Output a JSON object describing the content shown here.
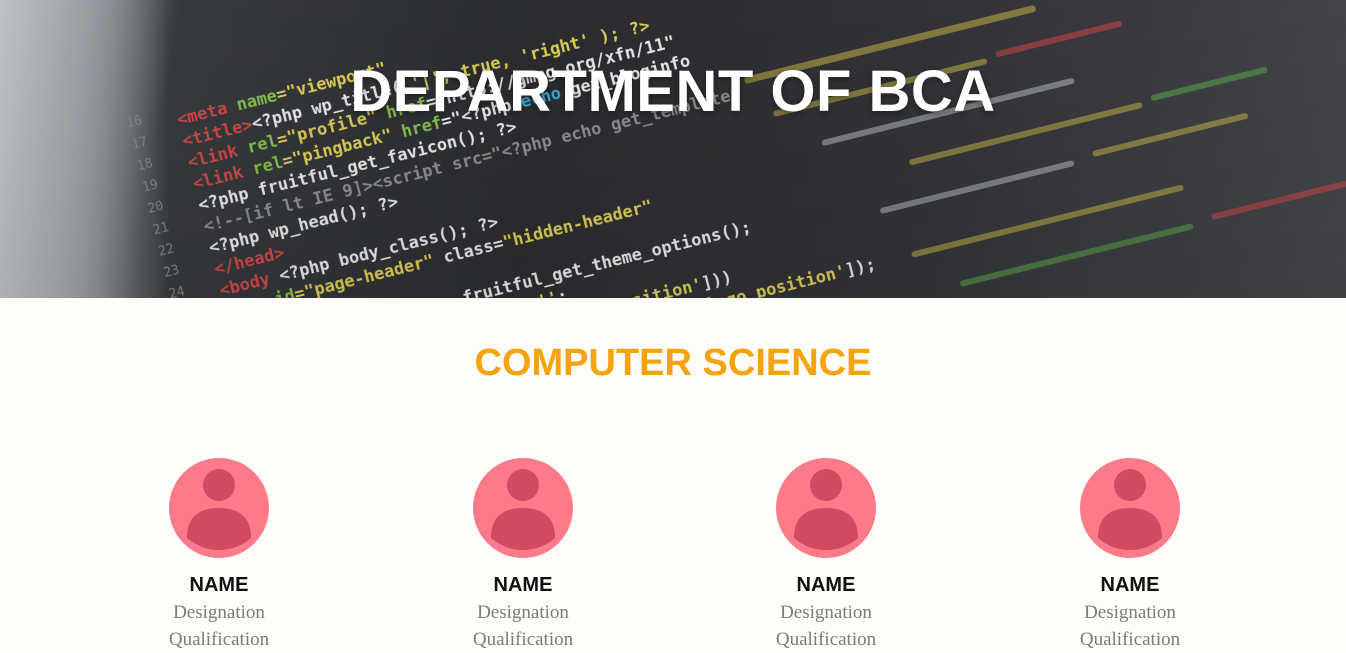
{
  "hero": {
    "title": "DEPARTMENT OF BCA"
  },
  "section": {
    "title": "COMPUTER SCIENCE"
  },
  "faculty": [
    {
      "name": "NAME",
      "designation": "Designation",
      "qualification": "Qualification"
    },
    {
      "name": "NAME",
      "designation": "Designation",
      "qualification": "Qualification"
    },
    {
      "name": "NAME",
      "designation": "Designation",
      "qualification": "Qualification"
    },
    {
      "name": "NAME",
      "designation": "Designation",
      "qualification": "Qualification"
    }
  ],
  "colors": {
    "accent": "#f5a30f",
    "avatar_bg": "#fd7a8b",
    "avatar_fg": "#d24a61"
  },
  "icons": {
    "avatar": "user-avatar-icon"
  }
}
